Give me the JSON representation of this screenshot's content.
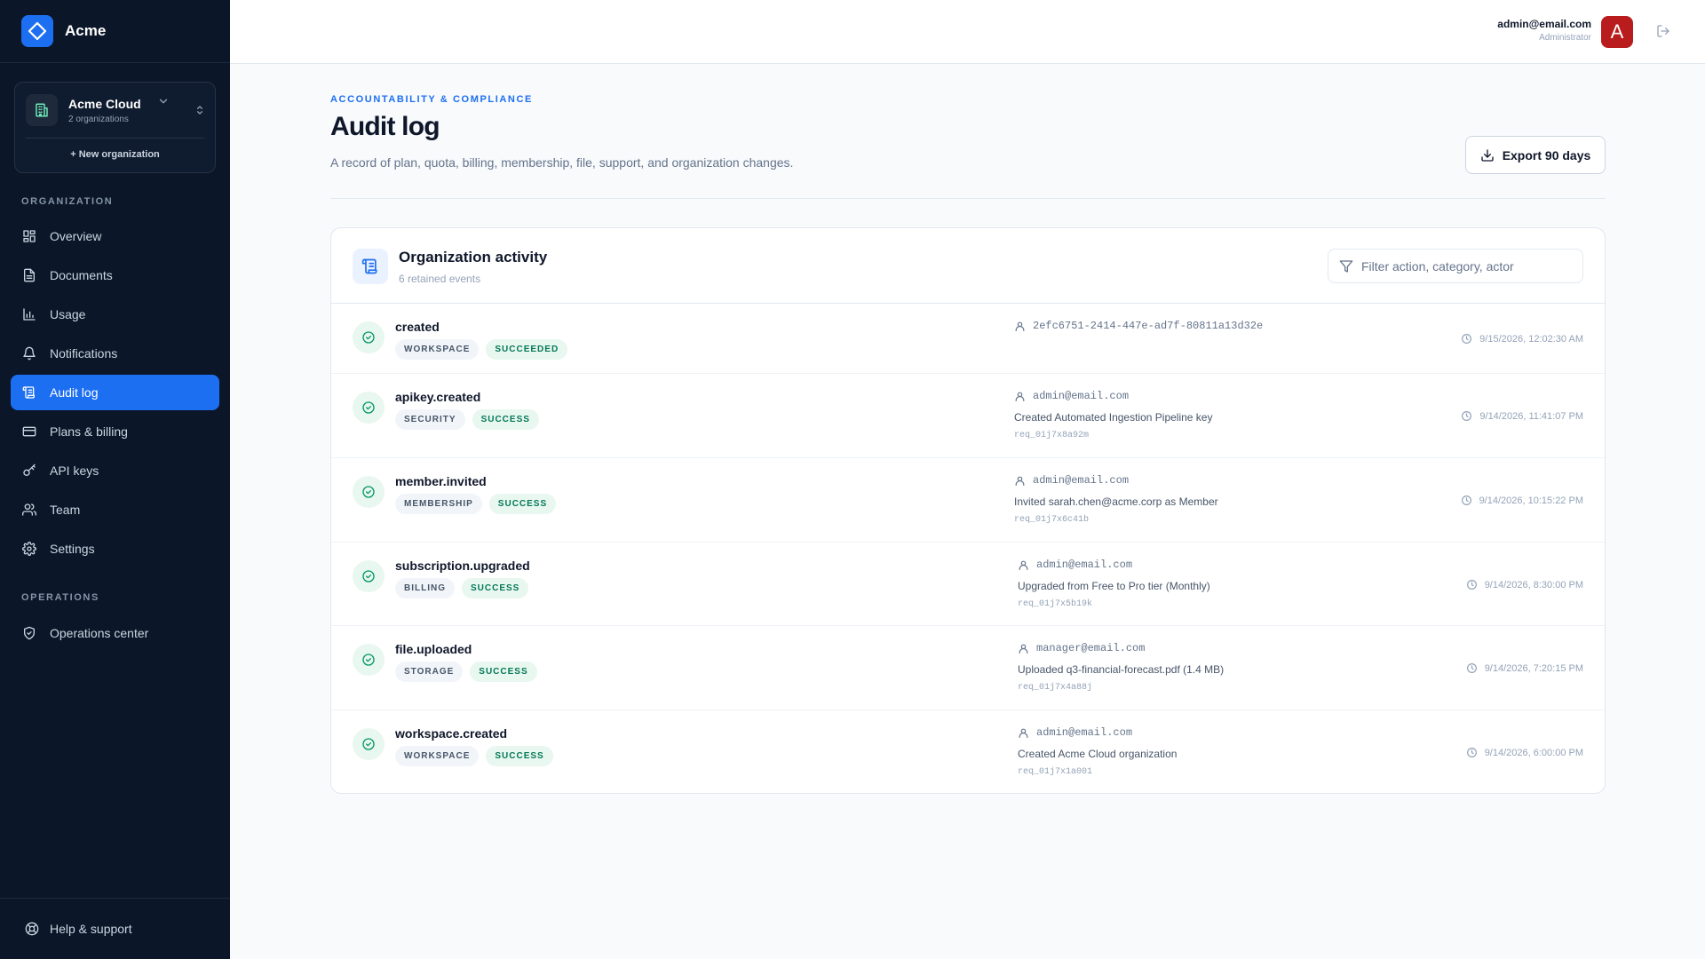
{
  "app": {
    "name": "Acme"
  },
  "org_switcher": {
    "name": "Acme Cloud",
    "count": "2 organizations",
    "new_label": "+ New organization"
  },
  "sections": {
    "organization": "ORGANIZATION",
    "operations": "OPERATIONS"
  },
  "nav": {
    "items": [
      {
        "label": "Overview",
        "icon": "grid-icon"
      },
      {
        "label": "Documents",
        "icon": "document-icon"
      },
      {
        "label": "Usage",
        "icon": "bar-chart-icon"
      },
      {
        "label": "Notifications",
        "icon": "bell-icon"
      },
      {
        "label": "Audit log",
        "icon": "scroll-icon",
        "active": true
      },
      {
        "label": "Plans & billing",
        "icon": "credit-card-icon"
      },
      {
        "label": "API keys",
        "icon": "key-icon"
      },
      {
        "label": "Team",
        "icon": "users-icon"
      },
      {
        "label": "Settings",
        "icon": "gear-icon"
      }
    ],
    "operations": [
      {
        "label": "Operations center",
        "icon": "shield-icon"
      }
    ]
  },
  "footer": {
    "help_label": "Help & support"
  },
  "user": {
    "email": "admin@email.com",
    "role": "Administrator",
    "avatar_letter": "A"
  },
  "page": {
    "eyebrow": "ACCOUNTABILITY & COMPLIANCE",
    "title": "Audit log",
    "description": "A record of plan, quota, billing, membership, file, support, and organization changes.",
    "export_label": "Export 90 days"
  },
  "panel": {
    "title": "Organization activity",
    "subtitle": "6 retained events",
    "filter_placeholder": "Filter action, category, actor"
  },
  "events": [
    {
      "action": "created",
      "category": "WORKSPACE",
      "status": "SUCCEEDED",
      "actor": "2efc6751-2414-447e-ad7f-80811a13d32e",
      "detail": "",
      "request_id": "",
      "time": "9/15/2026, 12:02:30 AM"
    },
    {
      "action": "apikey.created",
      "category": "SECURITY",
      "status": "SUCCESS",
      "actor": "admin@email.com",
      "detail": "Created Automated Ingestion Pipeline key",
      "request_id": "req_01j7x8a92m",
      "time": "9/14/2026, 11:41:07 PM"
    },
    {
      "action": "member.invited",
      "category": "MEMBERSHIP",
      "status": "SUCCESS",
      "actor": "admin@email.com",
      "detail": "Invited sarah.chen@acme.corp as Member",
      "request_id": "req_01j7x6c41b",
      "time": "9/14/2026, 10:15:22 PM"
    },
    {
      "action": "subscription.upgraded",
      "category": "BILLING",
      "status": "SUCCESS",
      "actor": "admin@email.com",
      "detail": "Upgraded from Free to Pro tier (Monthly)",
      "request_id": "req_01j7x5b19k",
      "time": "9/14/2026, 8:30:00 PM"
    },
    {
      "action": "file.uploaded",
      "category": "STORAGE",
      "status": "SUCCESS",
      "actor": "manager@email.com",
      "detail": "Uploaded q3-financial-forecast.pdf (1.4 MB)",
      "request_id": "req_01j7x4a88j",
      "time": "9/14/2026, 7:20:15 PM"
    },
    {
      "action": "workspace.created",
      "category": "WORKSPACE",
      "status": "SUCCESS",
      "actor": "admin@email.com",
      "detail": "Created Acme Cloud organization",
      "request_id": "req_01j7x1a001",
      "time": "9/14/2026, 6:00:00 PM"
    }
  ],
  "colors": {
    "accent": "#1d6ff2",
    "sidebar_bg": "#0b1628",
    "success": "#047857",
    "avatar": "#b91c1c"
  }
}
